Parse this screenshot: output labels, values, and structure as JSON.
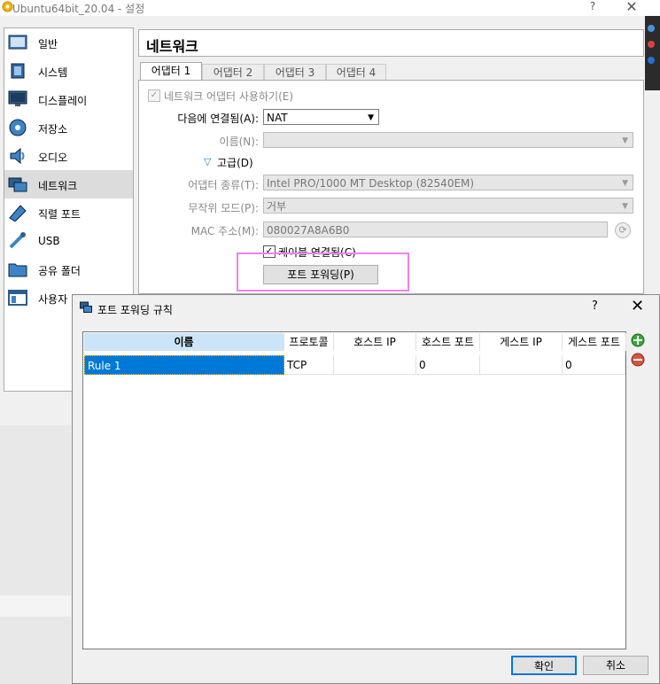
{
  "window": {
    "title": "Ubuntu64bit_20.04 - 설정",
    "help": "?",
    "close": "✕"
  },
  "sidebar": {
    "items": [
      {
        "label": "일반",
        "icon": "general-icon"
      },
      {
        "label": "시스템",
        "icon": "chip-icon"
      },
      {
        "label": "디스플레이",
        "icon": "monitor-icon"
      },
      {
        "label": "저장소",
        "icon": "disk-icon"
      },
      {
        "label": "오디오",
        "icon": "speaker-icon"
      },
      {
        "label": "네트워크",
        "icon": "network-icon"
      },
      {
        "label": "직렬 포트",
        "icon": "serial-icon"
      },
      {
        "label": "USB",
        "icon": "usb-icon"
      },
      {
        "label": "공유 폴더",
        "icon": "folder-icon"
      },
      {
        "label": "사용자",
        "icon": "ui-icon"
      }
    ]
  },
  "page": {
    "title": "네트워크"
  },
  "tabs": [
    "어댑터 1",
    "어댑터 2",
    "어댑터 3",
    "어댑터 4"
  ],
  "adapter": {
    "enable_label": "네트워크 어댑터 사용하기(E)",
    "attached_label": "다음에 연결됨(A):",
    "attached_value": "NAT",
    "name_label": "이름(N):",
    "name_value": "",
    "advanced_label": "고급(D)",
    "type_label": "어댑터 종류(T):",
    "type_value": "Intel PRO/1000 MT Desktop (82540EM)",
    "promisc_label": "무작위 모드(P):",
    "promisc_value": "거부",
    "mac_label": "MAC 주소(M):",
    "mac_value": "080027A8A6B0",
    "cable_label": "케이블 연결됨(C)",
    "port_forward_label": "포트 포워딩(P)"
  },
  "dialog": {
    "title": "포트 포워딩 규칙",
    "help": "?",
    "close": "✕",
    "columns": [
      "이름",
      "프로토콜",
      "호스트 IP",
      "호스트 포트",
      "게스트 IP",
      "게스트 포트"
    ],
    "rows": [
      {
        "name": "Rule 1",
        "protocol": "TCP",
        "host_ip": "",
        "host_port": "0",
        "guest_ip": "",
        "guest_port": "0"
      }
    ],
    "ok_label": "확인",
    "cancel_label": "취소"
  }
}
